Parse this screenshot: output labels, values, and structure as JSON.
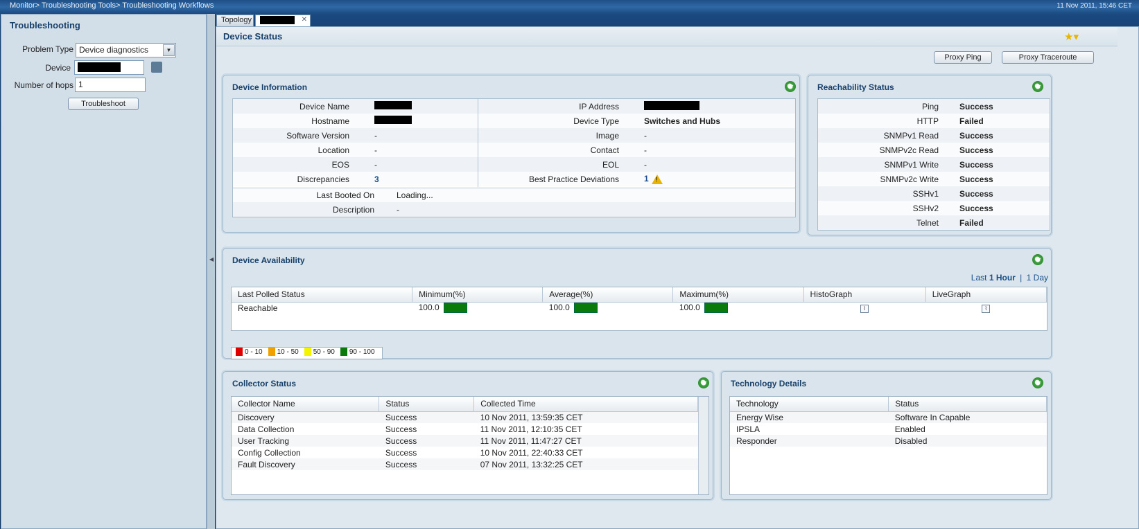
{
  "breadcrumb": "Monitor> Troubleshooting Tools> Troubleshooting Workflows",
  "datetime": "11 Nov 2011, 15:46 CET",
  "left_panel": {
    "title": "Troubleshooting",
    "problem_type_label": "Problem Type",
    "problem_type_value": "Device diagnostics",
    "device_label": "Device",
    "hops_label": "Number of hops",
    "hops_value": "1",
    "troubleshoot_button": "Troubleshoot"
  },
  "tabs": {
    "topology": "Topology",
    "close_glyph": "✕"
  },
  "main": {
    "title": "Device Status",
    "proxy_ping": "Proxy Ping",
    "proxy_traceroute": "Proxy Traceroute"
  },
  "device_info": {
    "title": "Device Information",
    "rows": [
      {
        "l1": "Device Name",
        "v1": "",
        "l2": "IP Address",
        "v2": ""
      },
      {
        "l1": "Hostname",
        "v1": "",
        "l2": "Device Type",
        "v2": "Switches and Hubs"
      },
      {
        "l1": "Software Version",
        "v1": "-",
        "l2": "Image",
        "v2": "-"
      },
      {
        "l1": "Location",
        "v1": "-",
        "l2": "Contact",
        "v2": "-"
      },
      {
        "l1": "EOS",
        "v1": "-",
        "l2": "EOL",
        "v2": "-"
      },
      {
        "l1": "Discrepancies",
        "v1": "3",
        "l2": "Best Practice Deviations",
        "v2": "1"
      }
    ],
    "last_booted_label": "Last Booted On",
    "last_booted_value": "Loading...",
    "description_label": "Description",
    "description_value": "-"
  },
  "reachability": {
    "title": "Reachability Status",
    "rows": [
      {
        "protocol": "Ping",
        "status": "Success"
      },
      {
        "protocol": "HTTP",
        "status": "Failed"
      },
      {
        "protocol": "SNMPv1 Read",
        "status": "Success"
      },
      {
        "protocol": "SNMPv2c Read",
        "status": "Success"
      },
      {
        "protocol": "SNMPv1 Write",
        "status": "Success"
      },
      {
        "protocol": "SNMPv2c Write",
        "status": "Success"
      },
      {
        "protocol": "SSHv1",
        "status": "Success"
      },
      {
        "protocol": "SSHv2",
        "status": "Success"
      },
      {
        "protocol": "Telnet",
        "status": "Failed"
      }
    ]
  },
  "availability": {
    "title": "Device Availability",
    "range_prefix": "Last",
    "range_active": "1 Hour",
    "range_sep": "|",
    "range_other": "1 Day",
    "columns": [
      "Last Polled Status",
      "Minimum(%)",
      "Average(%)",
      "Maximum(%)",
      "HistoGraph",
      "LiveGraph"
    ],
    "row": {
      "status": "Reachable",
      "min": "100.0",
      "avg": "100.0",
      "max": "100.0"
    },
    "legend": [
      {
        "label": "0 - 10",
        "color": "#e00000"
      },
      {
        "label": "10 - 50",
        "color": "#f0a000"
      },
      {
        "label": "50 - 90",
        "color": "#f4f400"
      },
      {
        "label": "90 - 100",
        "color": "#0a7a0a"
      }
    ]
  },
  "collector": {
    "title": "Collector Status",
    "columns": [
      "Collector Name",
      "Status",
      "Collected Time"
    ],
    "rows": [
      [
        "Discovery",
        "Success",
        "10 Nov 2011, 13:59:35 CET"
      ],
      [
        "Data Collection",
        "Success",
        "11 Nov 2011, 12:10:35 CET"
      ],
      [
        "User Tracking",
        "Success",
        "11 Nov 2011, 11:47:27 CET"
      ],
      [
        "Config Collection",
        "Success",
        "10 Nov 2011, 22:40:33 CET"
      ],
      [
        "Fault Discovery",
        "Success",
        "07 Nov 2011, 13:32:25 CET"
      ]
    ]
  },
  "technology": {
    "title": "Technology Details",
    "columns": [
      "Technology",
      "Status"
    ],
    "rows": [
      [
        "Energy Wise",
        "Software In Capable"
      ],
      [
        "IPSLA",
        "Enabled"
      ],
      [
        "Responder",
        "Disabled"
      ]
    ]
  }
}
